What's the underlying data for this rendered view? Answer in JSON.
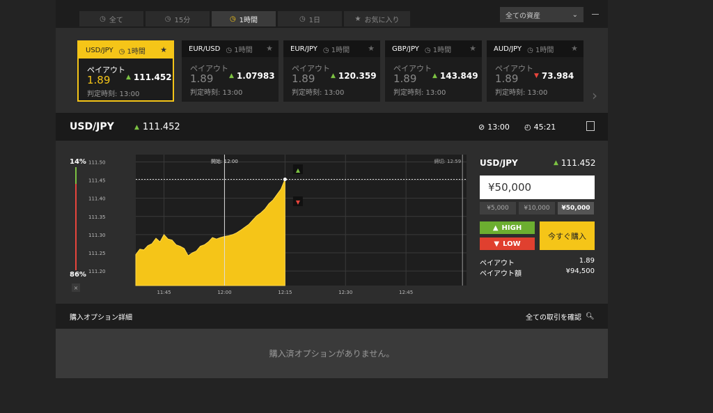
{
  "period_tabs": [
    {
      "label": "全て",
      "icon": "clock-icon"
    },
    {
      "label": "15分",
      "icon": "clock-icon"
    },
    {
      "label": "1時間",
      "icon": "clock-icon",
      "active": true
    },
    {
      "label": "1日",
      "icon": "clock-icon"
    },
    {
      "label": "お気に入り",
      "icon": "star-icon"
    }
  ],
  "asset_select": {
    "value": "全ての資産"
  },
  "cards": [
    {
      "pair": "USD/JPY",
      "period": "1時間",
      "payout_label": "ペイアウト",
      "payout": "1.89",
      "rate": "111.452",
      "dir": "up",
      "judge": "判定時刻: 13:00",
      "active": true
    },
    {
      "pair": "EUR/USD",
      "period": "1時間",
      "payout_label": "ペイアウト",
      "payout": "1.89",
      "rate": "1.07983",
      "dir": "up",
      "judge": "判定時刻: 13:00"
    },
    {
      "pair": "EUR/JPY",
      "period": "1時間",
      "payout_label": "ペイアウト",
      "payout": "1.89",
      "rate": "120.359",
      "dir": "up",
      "judge": "判定時刻: 13:00"
    },
    {
      "pair": "GBP/JPY",
      "period": "1時間",
      "payout_label": "ペイアウト",
      "payout": "1.89",
      "rate": "143.849",
      "dir": "up",
      "judge": "判定時刻: 13:00"
    },
    {
      "pair": "AUD/JPY",
      "period": "1時間",
      "payout_label": "ペイアウト",
      "payout": "1.89",
      "rate": "73.984",
      "dir": "down",
      "judge": "判定時刻: 13:00"
    }
  ],
  "selected": {
    "pair": "USD/JPY",
    "rate": "111.452",
    "close_time": "13:00",
    "remaining": "45:21"
  },
  "gauge": {
    "high_pct": "14%",
    "low_pct": "86%",
    "close": "×"
  },
  "chart_data": {
    "type": "area",
    "start_label": "開始: 12:00",
    "end_label": "締切: 12:59",
    "x_ticks": [
      "11:45",
      "12:00",
      "12:15",
      "12:30",
      "12:45"
    ],
    "y_ticks": [
      "111.50",
      "111.45",
      "111.40",
      "111.35",
      "111.30",
      "111.25",
      "111.20"
    ],
    "ylim": [
      111.16,
      111.52
    ],
    "xlim_minutes": [
      -22,
      60
    ],
    "current_rate": 111.452,
    "colors": {
      "fill": "#f5c518",
      "grid": "#3a3a3a",
      "bg": "#1e1e1e"
    },
    "series": [
      {
        "values": [
          [
            -22,
            111.245
          ],
          [
            -21,
            111.26
          ],
          [
            -20,
            111.258
          ],
          [
            -19,
            111.27
          ],
          [
            -18,
            111.275
          ],
          [
            -17,
            111.29
          ],
          [
            -16,
            111.28
          ],
          [
            -15,
            111.3
          ],
          [
            -14,
            111.288
          ],
          [
            -13,
            111.285
          ],
          [
            -12,
            111.272
          ],
          [
            -11,
            111.268
          ],
          [
            -10,
            111.262
          ],
          [
            -9,
            111.242
          ],
          [
            -8,
            111.25
          ],
          [
            -7,
            111.255
          ],
          [
            -6,
            111.268
          ],
          [
            -5,
            111.272
          ],
          [
            -4,
            111.28
          ],
          [
            -3,
            111.292
          ],
          [
            -2,
            111.288
          ],
          [
            -1,
            111.292
          ],
          [
            0,
            111.295
          ],
          [
            1,
            111.297
          ],
          [
            2,
            111.3
          ],
          [
            3,
            111.305
          ],
          [
            4,
            111.312
          ],
          [
            5,
            111.32
          ],
          [
            6,
            111.328
          ],
          [
            7,
            111.34
          ],
          [
            8,
            111.352
          ],
          [
            9,
            111.36
          ],
          [
            10,
            111.37
          ],
          [
            11,
            111.385
          ],
          [
            12,
            111.395
          ],
          [
            13,
            111.41
          ],
          [
            14,
            111.425
          ],
          [
            15,
            111.452
          ]
        ]
      }
    ]
  },
  "panel": {
    "pair": "USD/JPY",
    "rate": "111.452",
    "amount": "¥50,000",
    "quick_amounts": [
      "¥5,000",
      "¥10,000",
      "¥50,000"
    ],
    "high_label": "HIGH",
    "low_label": "LOW",
    "buy_label": "今すぐ購入",
    "payout_label": "ペイアウト",
    "payout_value": "1.89",
    "payout_amount_label": "ペイアウト額",
    "payout_amount_value": "¥94,500"
  },
  "options": {
    "title": "購入オプション詳細",
    "all_trades": "全ての取引を確認",
    "empty": "購入済オプションがありません。"
  }
}
